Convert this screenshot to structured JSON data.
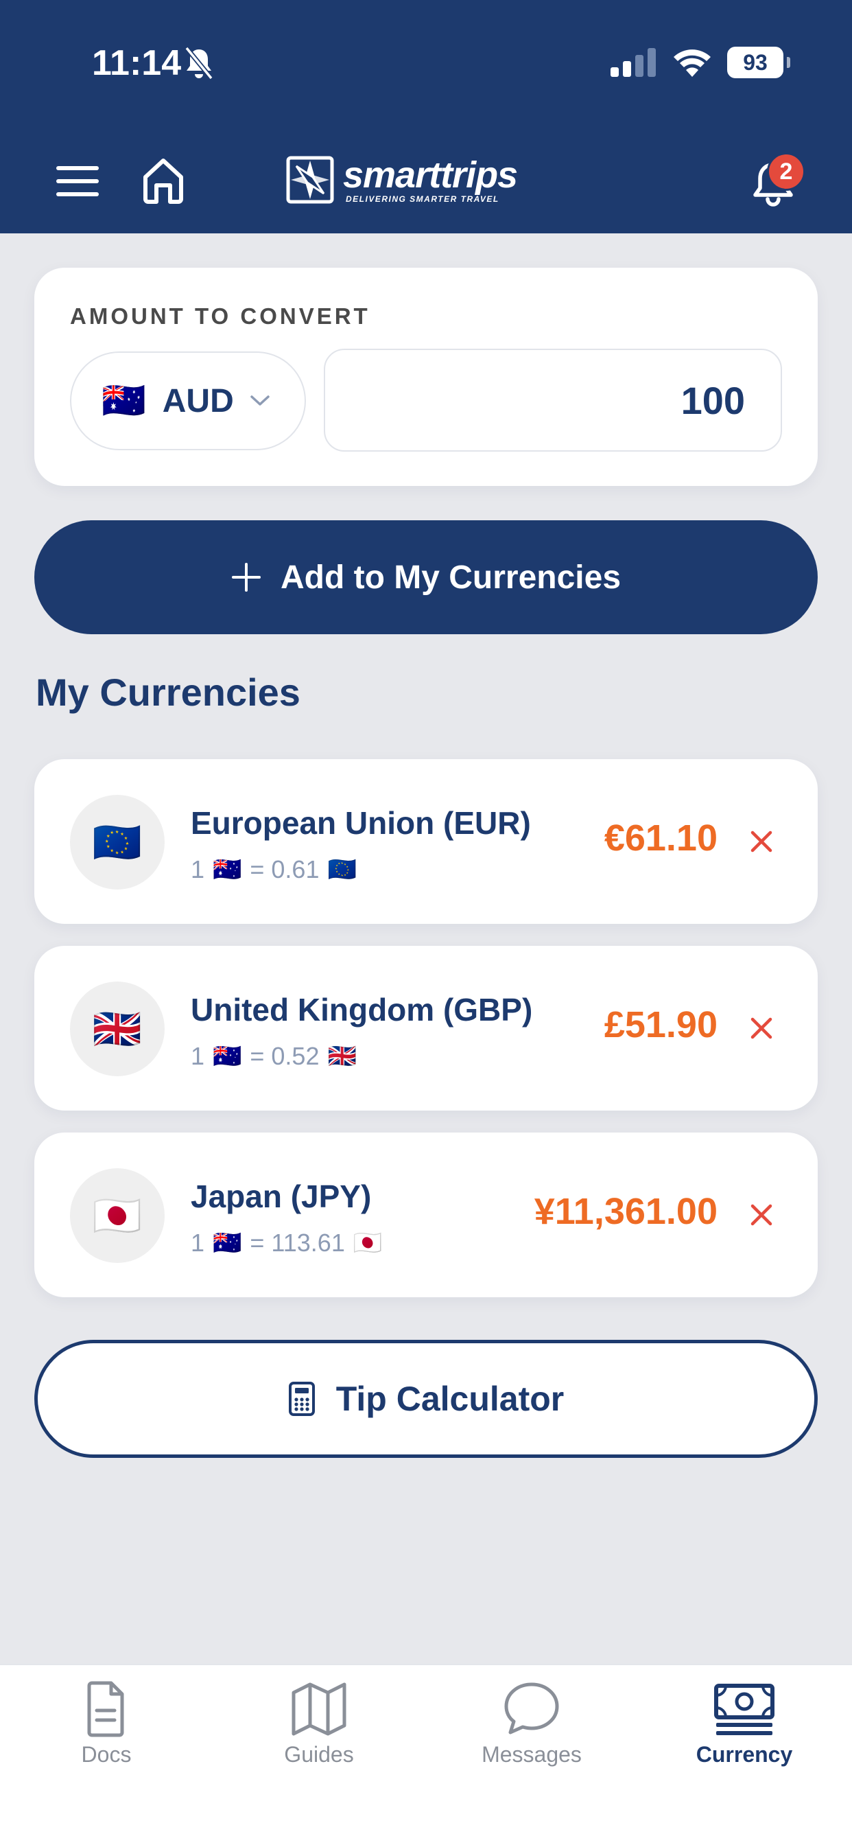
{
  "status_bar": {
    "time": "11:14",
    "battery": "93"
  },
  "header": {
    "logo_name": "smarttrips",
    "logo_tagline": "DELIVERING SMARTER TRAVEL",
    "notification_count": "2"
  },
  "converter": {
    "label": "AMOUNT TO CONVERT",
    "base_flag": "🇦🇺",
    "base_currency": "AUD",
    "amount": "100"
  },
  "add_button_label": "Add to My Currencies",
  "section_title": "My Currencies",
  "currencies": [
    {
      "flag": "🇪🇺",
      "name": "European Union (EUR)",
      "rate_one": "1",
      "base_flag": "🇦🇺",
      "rate_text": "= 0.61",
      "value": "€61.10"
    },
    {
      "flag": "🇬🇧",
      "name": "United Kingdom (GBP)",
      "rate_one": "1",
      "base_flag": "🇦🇺",
      "rate_text": "= 0.52",
      "value": "£51.90"
    },
    {
      "flag": "🇯🇵",
      "name": "Japan (JPY)",
      "rate_one": "1",
      "base_flag": "🇦🇺",
      "rate_text": "= 113.61",
      "value": "¥11,361.00"
    }
  ],
  "tip_button_label": "Tip Calculator",
  "tabs": [
    {
      "label": "Docs",
      "icon": "document-icon"
    },
    {
      "label": "Guides",
      "icon": "map-icon"
    },
    {
      "label": "Messages",
      "icon": "chat-bubble-icon"
    },
    {
      "label": "Currency",
      "icon": "banknote-icon"
    }
  ],
  "colors": {
    "brand_navy": "#1d3a6e",
    "accent_orange": "#ee6b24",
    "remove_red": "#e44a3c",
    "background": "#e7e8ec"
  }
}
